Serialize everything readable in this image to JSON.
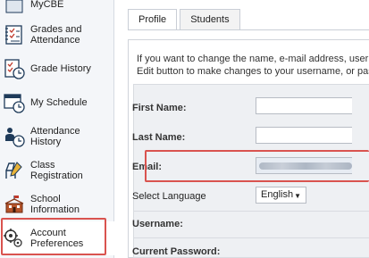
{
  "sidebar": {
    "items": [
      {
        "label": "MyCBE",
        "icon": "mycbe-icon"
      },
      {
        "label": "Grades and Attendance",
        "icon": "gradebook-icon"
      },
      {
        "label": "Grade History",
        "icon": "grade-history-icon"
      },
      {
        "label": "My Schedule",
        "icon": "schedule-icon"
      },
      {
        "label": "Attendance History",
        "icon": "attendance-history-icon"
      },
      {
        "label": "Class Registration",
        "icon": "class-registration-icon"
      },
      {
        "label": "School Information",
        "icon": "school-icon"
      },
      {
        "label": "Account Preferences",
        "icon": "account-preferences-icon"
      }
    ]
  },
  "tabs": [
    {
      "label": "Profile",
      "active": true
    },
    {
      "label": "Students",
      "active": false
    }
  ],
  "intro": {
    "line1": "If you want to change the name, e-mail address, userna",
    "line2": "Edit button to make changes to your username, or pass"
  },
  "form": {
    "first_name_label": "First Name:",
    "last_name_label": "Last Name:",
    "email_label": "Email:",
    "language_label": "Select Language",
    "language_value": "English",
    "username_label": "Username:",
    "current_password_label": "Current Password:"
  },
  "colors": {
    "highlight": "#d9534f",
    "sidebar_bg": "#f4f6f9",
    "form_bg": "#eef0f3"
  }
}
